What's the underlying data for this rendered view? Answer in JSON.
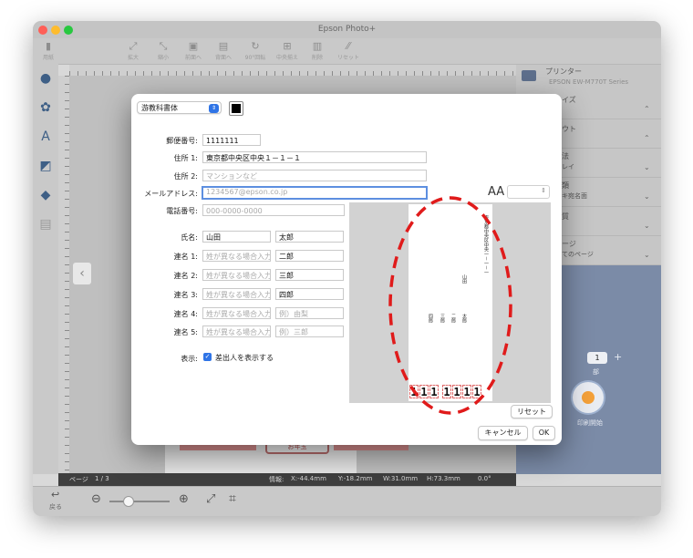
{
  "app": {
    "title": "Epson Photo+"
  },
  "toolbar": {
    "items": [
      {
        "label": "用紙",
        "icon": "trash-icon"
      },
      {
        "label": "拡大",
        "icon": "expand-icon"
      },
      {
        "label": "縮小",
        "icon": "shrink-icon"
      },
      {
        "label": "前面へ",
        "icon": "bring-front-icon"
      },
      {
        "label": "背面へ",
        "icon": "send-back-icon"
      },
      {
        "label": "90°回転",
        "icon": "rotate-icon"
      },
      {
        "label": "中央揃え",
        "icon": "align-center-icon"
      },
      {
        "label": "削除",
        "icon": "delete-icon"
      },
      {
        "label": "リセット",
        "icon": "reset-icon"
      }
    ]
  },
  "right_panel": {
    "printer_label": "プリンター",
    "printer_value": "EPSON EW-M770T Series",
    "rows": [
      {
        "label": "イズ",
        "value": ""
      },
      {
        "label": "ウト",
        "value": ""
      },
      {
        "label": "法",
        "value": "レイ"
      },
      {
        "label": "類",
        "value": "キ宛名面"
      },
      {
        "label": "質",
        "value": ""
      },
      {
        "label": "ージ",
        "value": "てのページ"
      }
    ],
    "copies": "1",
    "copies_unit": "部",
    "print_label": "印刷開始"
  },
  "status": {
    "page_label": "ページ",
    "page_value": "1 / 3",
    "info_label": "情報:",
    "x": "X:-44.4mm",
    "y": "Y:-18.2mm",
    "w": "W:31.0mm",
    "h": "H:73.3mm",
    "angle": "0.0°"
  },
  "bottom": {
    "back_label": "戻る",
    "zoom_level": 0.3
  },
  "canvas": {
    "card_tag": "お年玉"
  },
  "dialog": {
    "font": "游教科書体",
    "color": "#000000",
    "fields": {
      "postal_label": "郵便番号:",
      "postal_value": "1111111",
      "address1_label": "住所 1:",
      "address1_value": "東京都中央区中央１－１－１",
      "address2_label": "住所 2:",
      "address2_placeholder": "マンションなど",
      "email_label": "メールアドレス:",
      "email_placeholder": "1234567@epson.co.jp",
      "phone_label": "電話番号:",
      "phone_placeholder": "000-0000-0000",
      "name_label": "氏名:",
      "surname": "山田",
      "given": "太郎",
      "joint_placeholder_surname": "姓が異なる場合入力",
      "example_given_4": "例）由梨",
      "example_given_5": "例）三郎"
    },
    "joint": [
      {
        "label": "連名 1:",
        "given": "二郎"
      },
      {
        "label": "連名 2:",
        "given": "三郎"
      },
      {
        "label": "連名 3:",
        "given": "四郎"
      },
      {
        "label": "連名 4:",
        "given": ""
      },
      {
        "label": "連名 5:",
        "given": ""
      }
    ],
    "display_label": "表示:",
    "show_sender": "差出人を表示する",
    "aa_label": "AA",
    "preview": {
      "address_vertical": "東京都中央区中央一－一－一",
      "surname_vertical": "山田",
      "names_vertical": [
        "太郎",
        "二郎",
        "三郎",
        "四郎"
      ],
      "zip_digits": [
        "1",
        "1",
        "1",
        "1",
        "1",
        "1",
        "1"
      ]
    },
    "reset": "リセット",
    "cancel": "キャンセル",
    "ok": "OK"
  }
}
